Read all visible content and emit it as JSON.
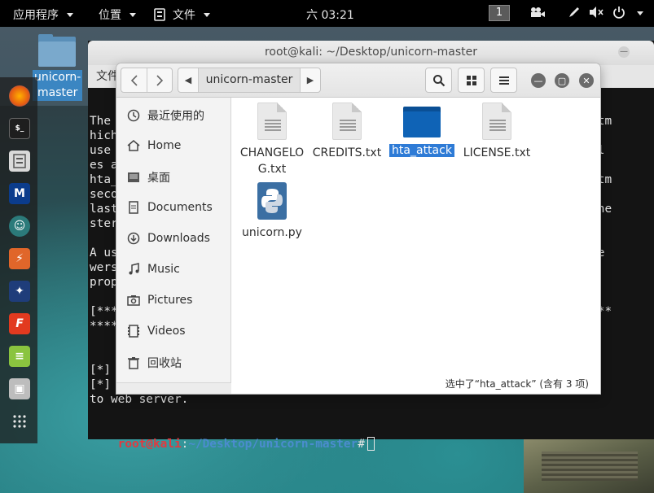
{
  "topbar": {
    "apps_menu": "应用程序",
    "places_menu": "位置",
    "files_menu": "文件",
    "clock": "六 03:21",
    "workspace": "1"
  },
  "desktop_icon": {
    "label": "unicorn-master"
  },
  "terminal": {
    "title": "root@kali: ~/Desktop/unicorn-master",
    "menu_first": "文件",
    "lines": [
      "The                                                               ndex.htm",
      "hich                                                                      ",
      "use                                                               de. All ",
      "es a                                                                      ",
      "hta_                                                              ndex.htm",
      "seco                                                                      ",
      "last                                                              unch the",
      "ster                                                                      ",
      "                                                                          ",
      "A us                                                              for the ",
      "wers                                                                      ",
      "prop                                                                      ",
      "                                                                          ",
      "[***                                                              ********",
      "****                                                                      ",
      "                                                                          ",
      "                                                                          ",
      "[*]                                                               \\/.     ",
      "[*]                                                               launch  ",
      "to web server.                                                            "
    ],
    "prompt_user": "root@kali",
    "prompt_sep": ":",
    "prompt_path": "~/Desktop/unicorn-master",
    "prompt_hash": "#"
  },
  "files": {
    "path_crumb": "unicorn-master",
    "sidebar": [
      {
        "label": "最近使用的",
        "icon": "clock-icon"
      },
      {
        "label": "Home",
        "icon": "home-icon"
      },
      {
        "label": "桌面",
        "icon": "desktop-icon"
      },
      {
        "label": "Documents",
        "icon": "document-icon"
      },
      {
        "label": "Downloads",
        "icon": "download-icon"
      },
      {
        "label": "Music",
        "icon": "music-icon"
      },
      {
        "label": "Pictures",
        "icon": "camera-icon"
      },
      {
        "label": "Videos",
        "icon": "film-icon"
      },
      {
        "label": "回收站",
        "icon": "trash-icon"
      }
    ],
    "items": [
      {
        "name_line1": "CHANGELO",
        "name_line2": "G.txt",
        "type": "text"
      },
      {
        "name_line1": "CREDITS.txt",
        "name_line2": "",
        "type": "text"
      },
      {
        "name_line1": "hta_attack",
        "name_line2": "",
        "type": "folder",
        "selected": true
      },
      {
        "name_line1": "LICENSE.txt",
        "name_line2": "",
        "type": "text"
      },
      {
        "name_line1": "unicorn.py",
        "name_line2": "",
        "type": "python"
      }
    ],
    "status": "选中了“hta_attack” (含有 3 项)"
  }
}
